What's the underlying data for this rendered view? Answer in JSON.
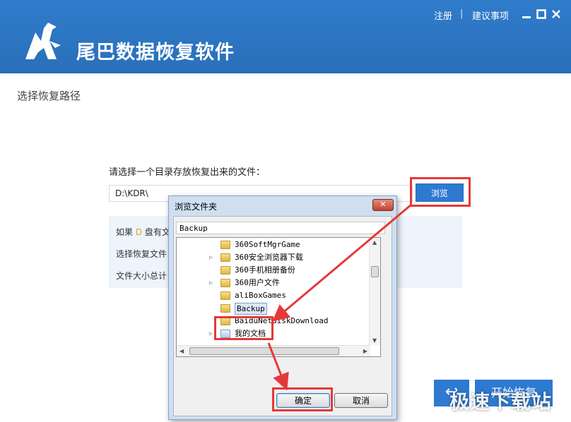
{
  "header": {
    "app_title": "尾巴数据恢复软件",
    "register_link": "注册",
    "separator": "|",
    "feedback_link": "建议事项",
    "bg_color": "#2b73c0"
  },
  "main": {
    "section_title": "选择恢复路径",
    "prompt": "请选择一个目录存放恢复出来的文件：",
    "path_value": "D:\\KDR\\",
    "browse_label": "浏览",
    "info": {
      "line1_prefix": "如果 ",
      "line1_drive": "D",
      "line1_suffix": " 盘有文",
      "line2": "选择恢复文件",
      "line3": "文件大小总计"
    },
    "back_icon": "↩",
    "start_label": "开始恢复"
  },
  "dialog": {
    "title": "浏览文件夹",
    "close_label": "✕",
    "path_value": "Backup",
    "tree_items": [
      {
        "label": "360SoftMgrGame",
        "expandable": false,
        "icon": "folder-icon"
      },
      {
        "label": "360安全浏览器下载",
        "expandable": true,
        "icon": "folder-icon"
      },
      {
        "label": "360手机相册备份",
        "expandable": false,
        "icon": "folder-icon"
      },
      {
        "label": "360用户文件",
        "expandable": true,
        "icon": "folder-icon"
      },
      {
        "label": "aliBoxGames",
        "expandable": false,
        "icon": "folder-icon"
      },
      {
        "label": "Backup",
        "expandable": false,
        "icon": "folder-icon",
        "selected": true
      },
      {
        "label": "BaiduNetdiskDownload",
        "expandable": false,
        "icon": "folder-icon"
      },
      {
        "label": "我的文档",
        "expandable": true,
        "icon": "documents-folder-icon"
      }
    ],
    "ok_label": "确定",
    "cancel_label": "取消"
  },
  "watermark": "极速下载站",
  "highlight_color": "#e63838"
}
